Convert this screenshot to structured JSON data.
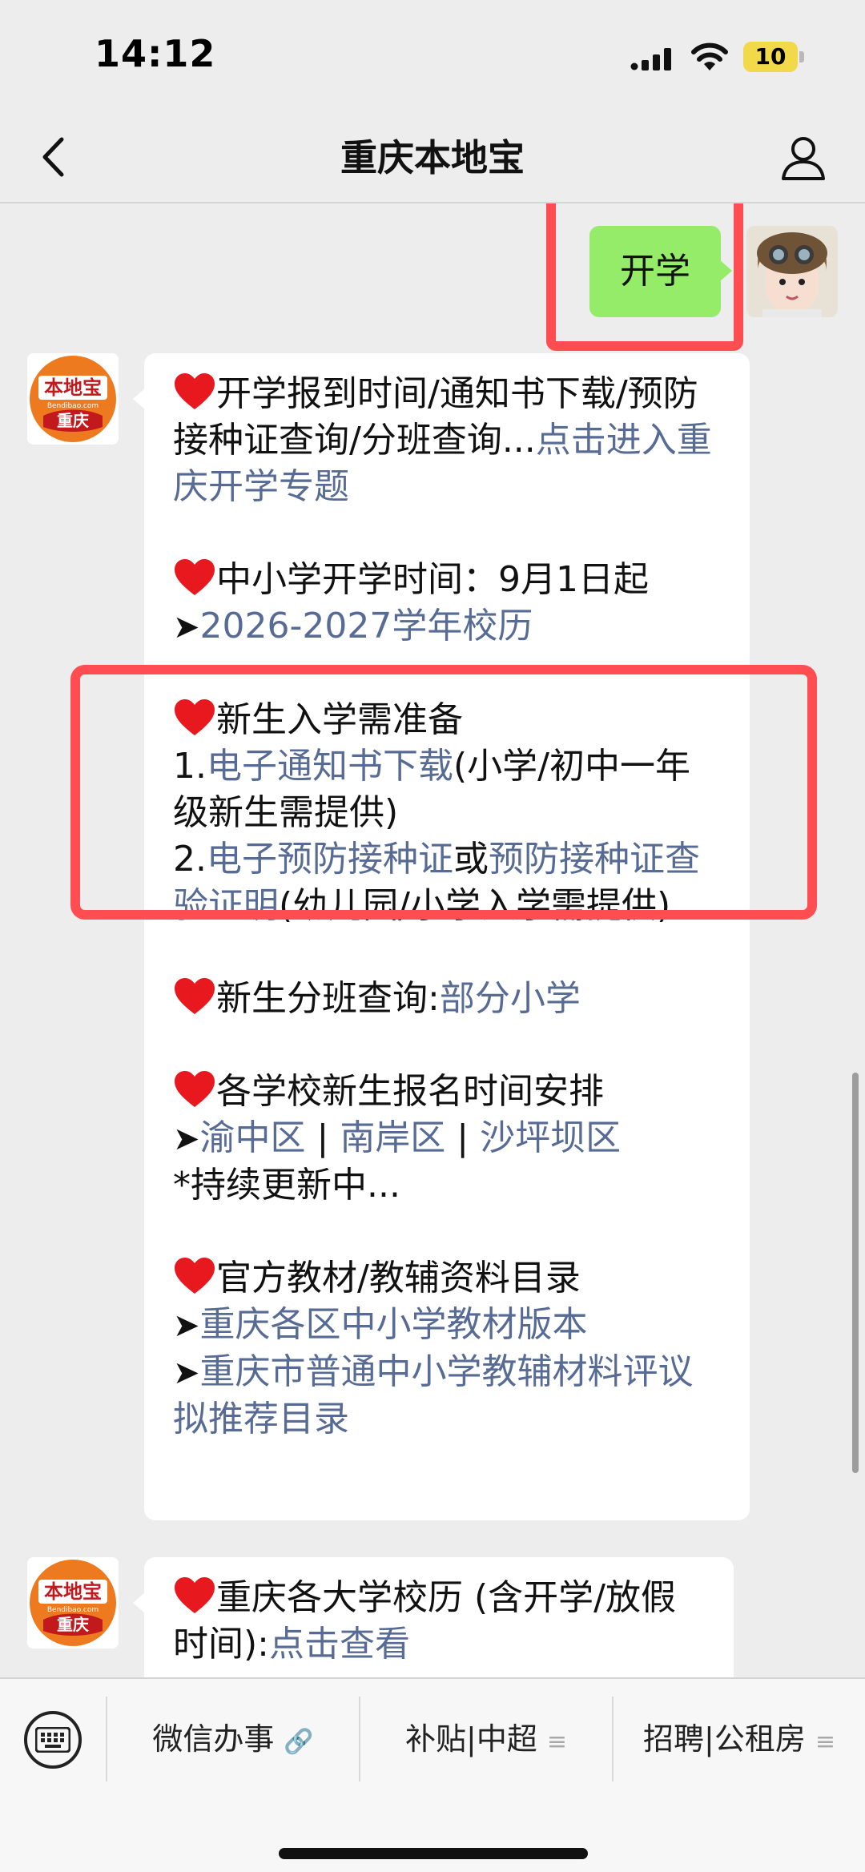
{
  "status_bar": {
    "time": "14:12",
    "battery_level": "10",
    "signal_icon": "cellular-signal-icon",
    "wifi_icon": "wifi-icon"
  },
  "nav": {
    "title": "重庆本地宝",
    "back_icon": "chevron-left-icon",
    "profile_icon": "person-icon"
  },
  "user_message": {
    "text": "开学",
    "avatar": "user-avatar"
  },
  "bot": {
    "logo_top": "本地宝",
    "logo_mid": "Bendibao.com",
    "logo_bottom": "重庆"
  },
  "message1": {
    "s1": {
      "text": "开学报到时间/通知书下载/预防接种证查询/分班查询...",
      "link": "点击进入重庆开学专题"
    },
    "s2": {
      "title": "中小学开学时间：9月1日起",
      "arrow": "➤",
      "link": "2026-2027学年校历"
    },
    "s3": {
      "title": "新生入学需准备",
      "l1_num": "1.",
      "l1_link": "电子通知书下载",
      "l1_text": "(小学/初中一年级新生需提供)",
      "l2_num": "2.",
      "l2_link1": "电子预防接种证",
      "l2_mid": "或",
      "l2_link2": "预防接种证查验证明",
      "l2_text": "(幼儿园/小学入学需提供)"
    },
    "s4": {
      "title": "新生分班查询:",
      "link": "部分小学"
    },
    "s5": {
      "title": "各学校新生报名时间安排",
      "arrow": "➤",
      "link1": "渝中区",
      "sep": " | ",
      "link2": "南岸区",
      "link3": "沙坪坝区",
      "note": "*持续更新中..."
    },
    "s6": {
      "title": "官方教材/教辅资料目录",
      "arrow": "➤",
      "link1": "重庆各区中小学教材版本",
      "link2": "重庆市普通中小学教辅材料评议拟推荐目录"
    }
  },
  "message2": {
    "text": "重庆各大学校历 (含开学/放假时间):",
    "link": "点击查看"
  },
  "bottom_menu": {
    "keyboard_icon": "keyboard-icon",
    "items": [
      {
        "label": "微信办事",
        "suffix": "🔗"
      },
      {
        "label": "补贴|中超",
        "suffix": "≡"
      },
      {
        "label": "招聘|公租房",
        "suffix": "≡"
      }
    ]
  },
  "colors": {
    "highlight": "#ff4d52",
    "link": "#576b95",
    "user_bubble": "#95ec69"
  }
}
